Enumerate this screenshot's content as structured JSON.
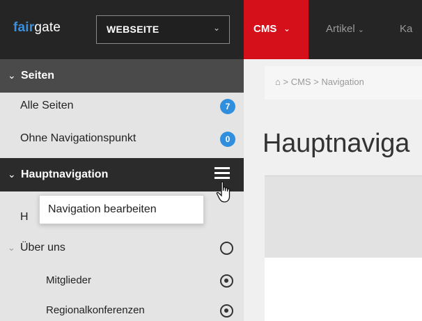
{
  "topbar": {
    "logo_bold": "fair",
    "logo_rest": "gate",
    "site_select": {
      "value": "WEBSEITE",
      "chevron": "⌄"
    },
    "nav": [
      {
        "label": "CMS",
        "chevron": "⌄",
        "active": true
      },
      {
        "label": "Artikel",
        "chevron": "⌄"
      },
      {
        "label": "Ka"
      }
    ],
    "accent_color": "#d6101a"
  },
  "sidebar": {
    "sections": [
      {
        "label": "Seiten",
        "items": [
          {
            "label": "Alle Seiten",
            "badge": "7"
          },
          {
            "label": "Ohne Navigationspunkt",
            "badge": "0"
          }
        ]
      },
      {
        "label": "Hauptnavigation",
        "menu_icon": "hamburger-menu-icon",
        "items": [
          {
            "label": "H"
          },
          {
            "label": "Über uns",
            "state_icon": "circle-empty-icon"
          },
          {
            "label": "Mitglieder",
            "state_icon": "circle-dot-icon"
          },
          {
            "label": "Regionalkonferenzen",
            "state_icon": "circle-dot-icon"
          }
        ]
      }
    ],
    "tooltip": "Navigation bearbeiten",
    "badge_color": "#2f8fde"
  },
  "main": {
    "breadcrumb": [
      "CMS",
      "Navigation"
    ],
    "breadcrumb_sep": ">",
    "page_title": "Hauptnaviga"
  }
}
